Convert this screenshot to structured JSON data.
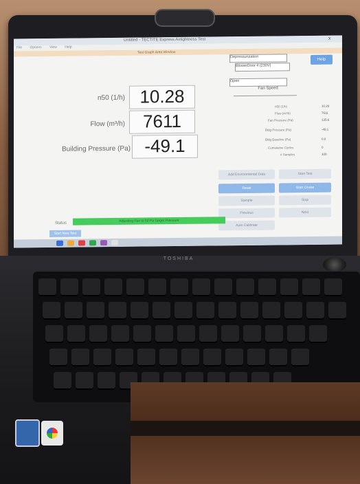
{
  "app": {
    "title": "Untitled - TECTITE Express Airtightness Test",
    "subtitle": "Test Graph Area Window",
    "menu": [
      "File",
      "Options",
      "View",
      "Help"
    ],
    "close": "x"
  },
  "readings": [
    {
      "label": "n50 (1/h)",
      "value": "10.28"
    },
    {
      "label": "Flow (m³/h)",
      "value": "7611"
    },
    {
      "label": "Building Pressure (Pa)",
      "value": "-49.1"
    }
  ],
  "controls": {
    "orientation": "Depressurization",
    "device": "BlowerDoor 4 (230V)",
    "ring": "Open",
    "fan_speed_label": "Fan Speed",
    "help": "Help"
  },
  "right_table": [
    {
      "label": "n50 (1/h)",
      "value": "10.28"
    },
    {
      "label": "Flow (m³/h)",
      "value": "7611"
    },
    {
      "label": "Fan Pressure (Pa)",
      "value": "135.6"
    },
    {
      "label": "Bldg Pressure (Pa)",
      "value": "-49.1"
    },
    {
      "label": "Bldg Baseline (Pa)",
      "value": "0.0"
    },
    {
      "label": "Cumulative Cycles",
      "value": "0"
    },
    {
      "label": "# Samples",
      "value": "100"
    }
  ],
  "buttons": {
    "add_reading": "Add Environmental Data",
    "start_test": "Start Test",
    "reset": "Reset",
    "start_cruise": "Start Cruise",
    "sample": "Sample",
    "stop": "Stop",
    "previous": "Previous",
    "next": "Next",
    "auto_calibrate": "Auto Calibrate"
  },
  "status": {
    "label": "Status",
    "message": "Adjusting Fan to 50 Pa Target Pressure"
  },
  "start_new_test": "Start New Test",
  "laptop_brand": "TOSHIBA",
  "taskbar_icons": [
    "#3a6fd8",
    "#f2a93b",
    "#e04040",
    "#2fa84f",
    "#9b59b6",
    "#e0e0e0"
  ]
}
